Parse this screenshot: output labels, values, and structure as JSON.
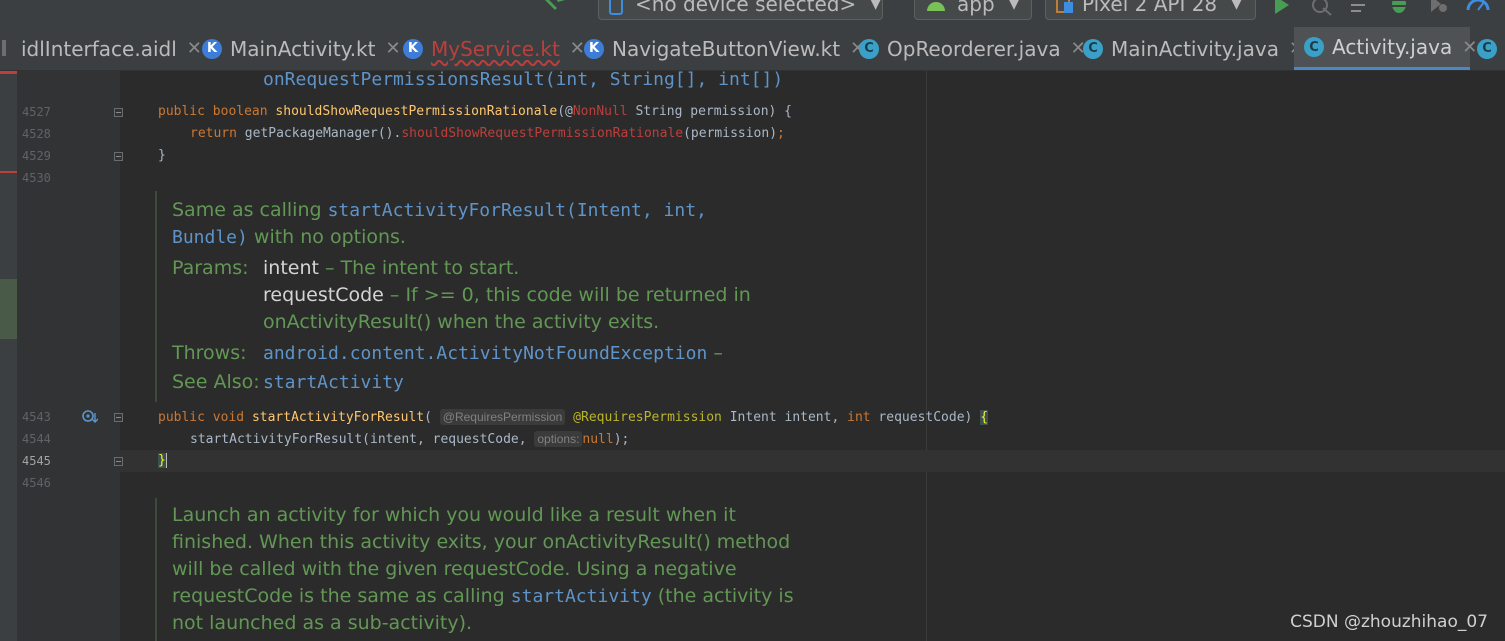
{
  "toolbar": {
    "device_selector": "<no device selected>",
    "run_config": "app",
    "avd": "Pixel 2 API 28"
  },
  "tabs": [
    {
      "label": "idlInterface.aidl",
      "type": "aidl",
      "active": false
    },
    {
      "label": "MainActivity.kt",
      "type": "kt",
      "active": false
    },
    {
      "label": "MyService.kt",
      "type": "kt",
      "active": false
    },
    {
      "label": "NavigateButtonView.kt",
      "type": "kt",
      "active": false
    },
    {
      "label": "OpReorderer.java",
      "type": "java",
      "active": false
    },
    {
      "label": "MainActivity.java",
      "type": "java",
      "active": false
    },
    {
      "label": "Activity.java",
      "type": "java",
      "active": true
    }
  ],
  "editor": {
    "top_doc_tail": "onRequestPermissionsResult(int, String[], int[])",
    "line_numbers": [
      "4527",
      "4528",
      "4529",
      "4530",
      "4543",
      "4544",
      "4545",
      "4546"
    ],
    "current_line": "4545",
    "code": {
      "l4527": {
        "kw1": "public",
        "kw2": "boolean",
        "name": "shouldShowRequestPermissionRationale",
        "open": "(@",
        "ann": "NonNull",
        "rest": " String permission) {"
      },
      "l4528": {
        "kw": "return",
        "call": " getPackageManager().",
        "method": "shouldShowRequestPermissionRationale",
        "args": "(permission)",
        "semi": ";"
      },
      "l4529": "}",
      "l4543": {
        "kw1": "public",
        "kw2": "void",
        "name": "startActivityForResult",
        "open": "(",
        "hint": "@RequiresPermission",
        "ann": "@RequiresPermission",
        "rest1": " Intent intent, ",
        "kw3": "int",
        "rest2": " requestCode) ",
        "brace": "{"
      },
      "l4544": {
        "call": "startActivityForResult(intent, requestCode, ",
        "hint": "options:",
        "kw": "null",
        "tail": ");"
      },
      "l4545": "}"
    }
  },
  "doc1": {
    "summary_prefix": "Same as calling ",
    "summary_link": "startActivityForResult(Intent, int,",
    "summary_link2": "Bundle)",
    "summary_suffix": " with no options.",
    "params_label": "Params:",
    "param1_name": "intent",
    "param1_desc": " – The intent to start.",
    "param2_name": "requestCode",
    "param2_desc": " – If >= 0, this code will be returned in",
    "param2_desc2": "onActivityResult() when the activity exits.",
    "throws_label": "Throws:",
    "throws_value": "android.content.ActivityNotFoundException",
    "throws_dash": " –",
    "see_also_label": "See Also:",
    "see_also_value": "startActivity"
  },
  "doc2": {
    "line1": "Launch an activity for which you would like a result when it",
    "line2": "finished. When this activity exits, your onActivityResult() method",
    "line3": "will be called with the given requestCode. Using a negative",
    "line4_prefix": "requestCode is the same as calling ",
    "line4_link": "startActivity",
    "line4_suffix": " (the activity is",
    "line5": "not launched as a sub-activity)."
  },
  "watermark": "CSDN @zhouzhihao_07",
  "colors": {
    "background": "#2b2b2b",
    "doc_text": "#629755",
    "keyword": "#cc7832",
    "method": "#ffc66d",
    "link": "#5e94c9",
    "active_tab_underline": "#4a88c7"
  }
}
